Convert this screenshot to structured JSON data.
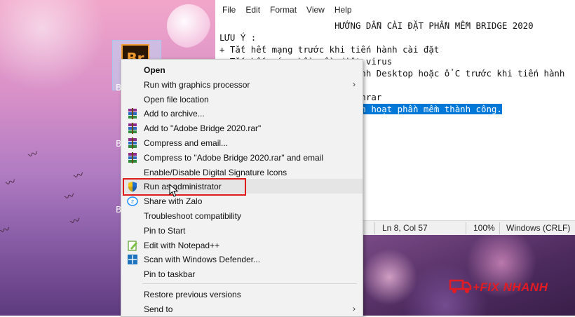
{
  "desktop": {
    "icon_label": "Br",
    "icon_caption_initial": "B"
  },
  "notepad": {
    "menu": [
      "File",
      "Edit",
      "Format",
      "View",
      "Help"
    ],
    "lines": [
      {
        "text": "                      HƯỚNG DẪN CÀI ĐẶT PHẦN MỀM BRIDGE 2020",
        "selected_part": ""
      },
      {
        "text": "LƯU Ý :",
        "selected_part": ""
      },
      {
        "text": "+ Tắt hết mạng trước khi tiến hành cài đặt",
        "selected_part": ""
      },
      {
        "text": "+ Tắt hết các phần mềm diệt virus",
        "selected_part": ""
      },
      {
        "text": "                         hình Desktop hoặc ổ C trước khi tiến hành",
        "selected_part": ""
      },
      {
        "text": "",
        "selected_part": ""
      },
      {
        "text": "                         Winrar",
        "selected_part": ""
      },
      {
        "text": "                         ",
        "selected_part": "ích hoạt phần mềm thành công."
      }
    ],
    "status": {
      "position": "Ln 8, Col 57",
      "zoom": "100%",
      "eol": "Windows (CRLF)"
    }
  },
  "brand": {
    "text": "+FIX NHANH",
    "color": "#e31b23"
  },
  "context_menu": {
    "items": [
      {
        "label": "Open",
        "bold": true,
        "icon": "",
        "submenu": false
      },
      {
        "label": "Run with graphics processor",
        "icon": "",
        "submenu": true
      },
      {
        "label": "Open file location",
        "icon": "",
        "submenu": false
      },
      {
        "label": "Add to archive...",
        "icon": "winrar-icon",
        "submenu": false
      },
      {
        "label": "Add to \"Adobe Bridge 2020.rar\"",
        "icon": "winrar-icon",
        "submenu": false
      },
      {
        "label": "Compress and email...",
        "icon": "winrar-icon",
        "submenu": false
      },
      {
        "label": "Compress to \"Adobe Bridge 2020.rar\" and email",
        "icon": "winrar-icon",
        "submenu": false
      },
      {
        "label": "Enable/Disable Digital Signature Icons",
        "icon": "",
        "submenu": false
      },
      {
        "label": "Run as administrator",
        "icon": "uac-shield-icon",
        "submenu": false,
        "highlighted": true
      },
      {
        "label": "Share with Zalo",
        "icon": "zalo-icon",
        "submenu": false
      },
      {
        "label": "Troubleshoot compatibility",
        "icon": "",
        "submenu": false
      },
      {
        "label": "Pin to Start",
        "icon": "",
        "submenu": false
      },
      {
        "label": "Edit with Notepad++",
        "icon": "notepadpp-icon",
        "submenu": false
      },
      {
        "label": "Scan with Windows Defender...",
        "icon": "defender-icon",
        "submenu": false
      },
      {
        "label": "Pin to taskbar",
        "icon": "",
        "submenu": false
      },
      {
        "label": "Restore previous versions",
        "icon": "",
        "submenu": false
      },
      {
        "label": "Send to",
        "icon": "",
        "submenu": true
      }
    ],
    "submenu_arrow": "›"
  }
}
